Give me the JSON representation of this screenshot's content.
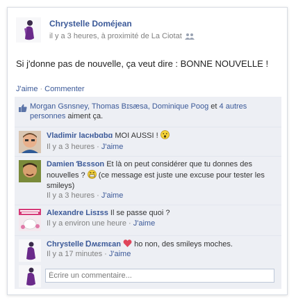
{
  "post": {
    "author": "Chrystelle Doméjean",
    "meta": "il y a 3 heures, à proximité de La Ciotat",
    "status": "Si j'donne pas de nouvelle, ça veut dire : BONNE NOUVELLE !",
    "actions": {
      "like": "J'aime",
      "comment": "Commenter"
    }
  },
  "likes": {
    "names_link": "Morgan Gsnsney, Thomas Bɪsæsa, Dominique Poᴏɡ",
    "middle": " et ",
    "others_link": "4 autres personnes",
    "suffix": " aiment ça."
  },
  "comments": [
    {
      "author": "Vladimir lacʜbɑbɑ",
      "text": "MOI AUSSI !",
      "time": "Il y a 3 heures",
      "like": "J'aime",
      "emoji": "gasp-emoji"
    },
    {
      "author": "Damien Ɓɛsson",
      "text": "Et là on peut considérer que tu donnes des nouvelles ? ",
      "text2": " (ce message est juste une excuse pour tester les smileys)",
      "time": "Il y a 3 heures",
      "like": "J'aime",
      "emoji": "grin-emoji"
    },
    {
      "author": "Alexandre Lisɪss",
      "text": "Il se passe quoi ?",
      "time": "Il y a environ une heure",
      "like": "J'aime"
    },
    {
      "author": "Chrystelle Ɒʍɛmɛan",
      "text": " ho non, des smileys moches.",
      "time": "Il y a 17 minutes",
      "like": "J'aime",
      "emoji": "heart-emoji"
    }
  ],
  "write_comment": {
    "placeholder": "Écrire un commentaire..."
  },
  "colors": {
    "link": "#3b5998",
    "ufi_bg": "#edeff4",
    "meta": "#808080"
  }
}
